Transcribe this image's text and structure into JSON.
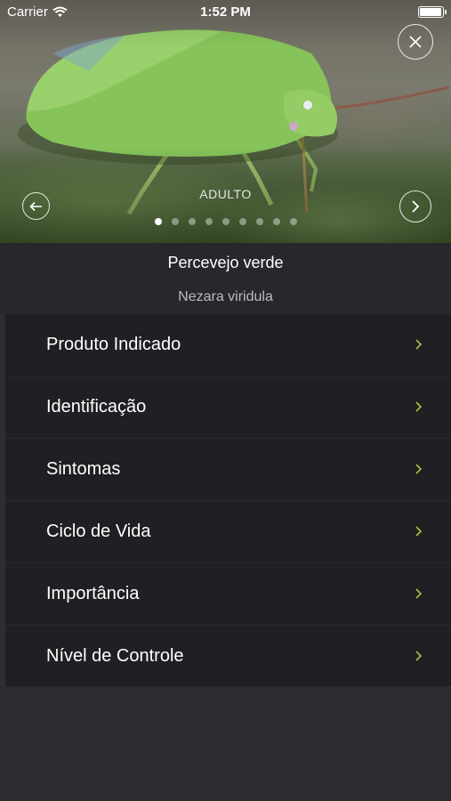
{
  "status_bar": {
    "carrier": "Carrier",
    "time": "1:52 PM",
    "battery_level": 1.0
  },
  "gallery": {
    "stage_label": "ADULTO",
    "page_count": 9,
    "active_index": 0,
    "prev_icon": "arrow-left-circle-icon",
    "next_icon": "arrow-right-circle-icon",
    "close_icon": "close-circle-icon"
  },
  "pest": {
    "common_name": "Percevejo verde",
    "scientific_name": "Nezara viridula"
  },
  "menu": {
    "items": [
      {
        "label": "Produto Indicado"
      },
      {
        "label": "Identificação"
      },
      {
        "label": "Sintomas"
      },
      {
        "label": "Ciclo de Vida"
      },
      {
        "label": "Importância"
      },
      {
        "label": "Nível de Controle"
      }
    ],
    "chevron_icon": "chevron-right-icon",
    "chevron_color": "#a9c23f"
  },
  "colors": {
    "background": "#2b2c30",
    "row_background": "#1f2023",
    "accent": "#a9c23f"
  }
}
